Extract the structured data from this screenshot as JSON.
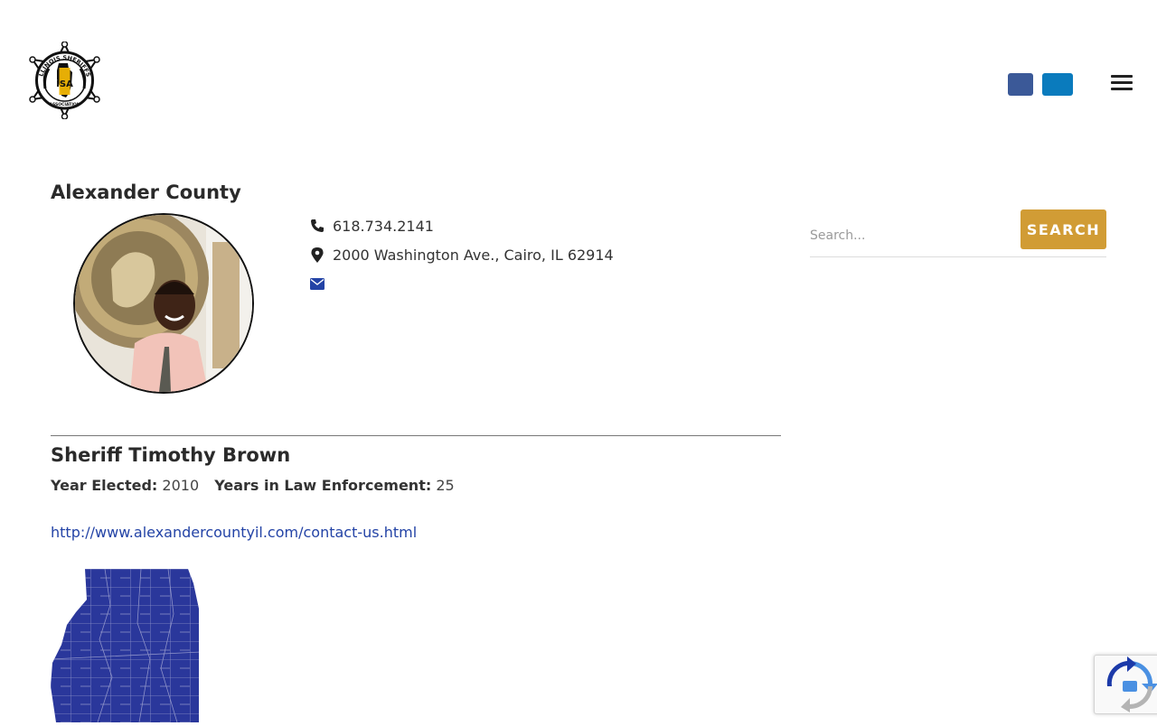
{
  "header": {
    "logo_icon": "illinois-sheriffs-association-star-logo",
    "logo_text_top": "ILLINOIS SHERIFFS'",
    "logo_text_bottom": "ASSOCIATION",
    "logo_monogram": "ISA",
    "social": [
      {
        "name": "facebook-icon",
        "color": "#3b5998"
      },
      {
        "name": "linkedin-icon",
        "color": "#0a7bbd"
      }
    ],
    "menu_icon": "hamburger-menu-icon"
  },
  "county": {
    "title": "Alexander County",
    "phone": "618.734.2141",
    "address": "2000 Washington Ave., Cairo, IL 62914",
    "icons": {
      "phone": "phone-icon",
      "address": "map-marker-icon",
      "email": "envelope-icon"
    },
    "icon_color": "#222222",
    "email_icon_color": "#2343a6"
  },
  "sheriff": {
    "name": "Sheriff Timothy Brown",
    "year_elected_label": "Year Elected:",
    "year_elected": "2010",
    "years_le_label": "Years in Law Enforcement:",
    "years_le": "25",
    "website": "http://www.alexandercountyil.com/contact-us.html"
  },
  "map": {
    "name": "illinois-county-map",
    "fill": "#2a379b",
    "border": "#8e93c9"
  },
  "search": {
    "placeholder": "Search...",
    "button_label": "SEARCH",
    "button_color": "#d19c35"
  },
  "recaptcha": {
    "icon": "recaptcha-icon"
  }
}
